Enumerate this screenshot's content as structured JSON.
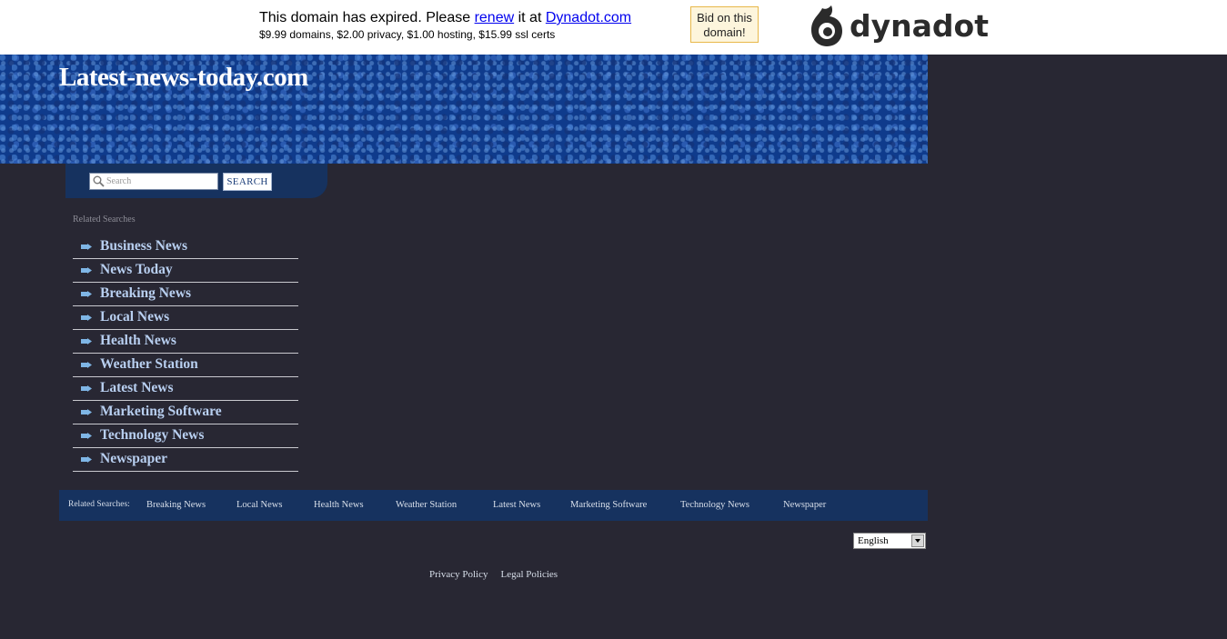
{
  "banner": {
    "expired_prefix": "This domain has expired. Please ",
    "renew_link": "renew",
    "expired_mid": " it at ",
    "dynadot_link": "Dynadot.com",
    "prices": "$9.99 domains, $2.00 privacy, $1.00 hosting, $15.99 ssl certs",
    "bid_button": "Bid on this domain!",
    "logo_text": "dynadot"
  },
  "header": {
    "site_title": "Latest-news-today.com"
  },
  "search": {
    "placeholder": "Search",
    "button_label": "SEARCH"
  },
  "sidebar": {
    "label": "Related Searches",
    "items": [
      "Business News",
      "News Today",
      "Breaking News",
      "Local News",
      "Health News",
      "Weather Station",
      "Latest News",
      "Marketing Software",
      "Technology News",
      "Newspaper"
    ]
  },
  "bottom_bar": {
    "label": "Related Searches:",
    "items": [
      "Breaking News",
      "Local News",
      "Health News",
      "Weather Station",
      "Latest News",
      "Marketing Software",
      "Technology News",
      "Newspaper"
    ]
  },
  "language": {
    "selected": "English"
  },
  "footer": {
    "privacy": "Privacy Policy",
    "legal": "Legal Policies"
  }
}
